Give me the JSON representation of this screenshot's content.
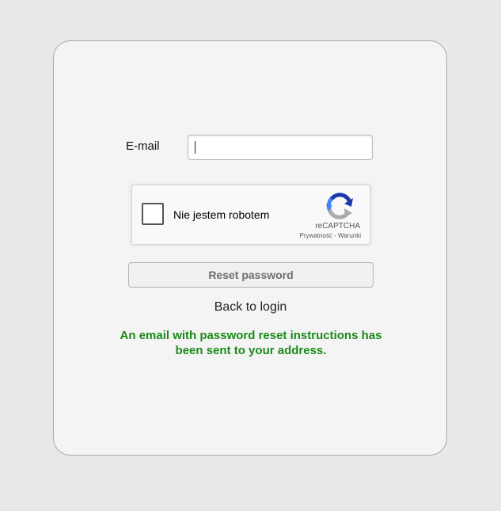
{
  "form": {
    "email_label": "E-mail",
    "email_value": "",
    "email_placeholder": "",
    "reset_button_label": "Reset password",
    "back_link_label": "Back to login"
  },
  "recaptcha": {
    "checkbox_label": "Nie jestem robotem",
    "brand": "reCAPTCHA",
    "privacy_link": "Prywatność",
    "separator": " - ",
    "terms_link": "Warunki",
    "checked": false
  },
  "status": {
    "message": "An email with password reset instructions has been sent to your address.",
    "color": "#1a8a1a"
  },
  "colors": {
    "page_background": "#e8e8e8",
    "card_background": "#f4f4f4",
    "recaptcha_blue": "#1c3aa9",
    "recaptcha_light_blue": "#4285f4",
    "recaptcha_gray": "#ababab"
  },
  "icons": {
    "recaptcha_logo": "recaptcha-logo-icon"
  }
}
